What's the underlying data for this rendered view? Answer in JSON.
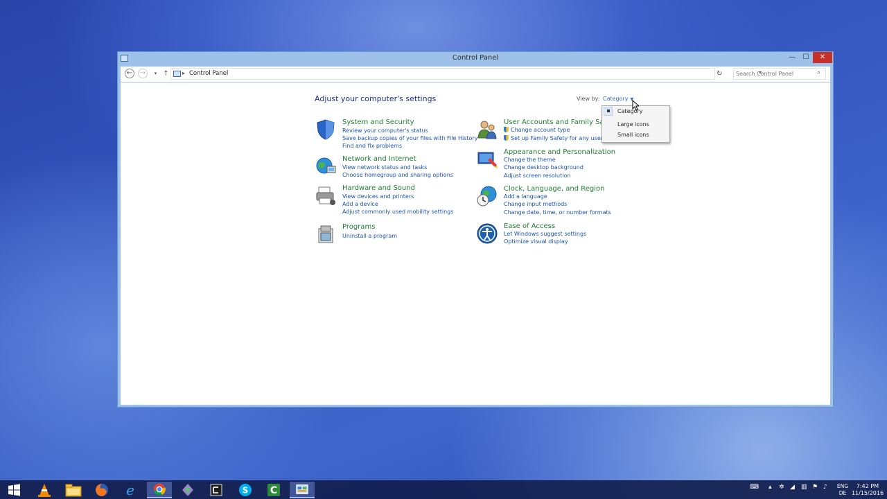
{
  "window": {
    "title": "Control Panel",
    "minimize_label": "—",
    "maximize_label": "☐",
    "close_label": "✕"
  },
  "address_bar": {
    "back_icon": "←",
    "forward_icon": "→",
    "recent_icon": "▾",
    "up_icon": "↑",
    "separator": "▸",
    "path": "Control Panel",
    "dropdown_icon": "▾",
    "refresh_icon": "↻",
    "search_placeholder": "Search Control Panel",
    "search_icon": "⌕"
  },
  "content": {
    "heading": "Adjust your computer's settings",
    "view_by_label": "View by:",
    "view_by_value": "Category",
    "view_by_arrow": "▼"
  },
  "dropdown": {
    "items": [
      "Category",
      "Large icons",
      "Small icons"
    ],
    "selected": "Category"
  },
  "categories_left": [
    {
      "title": "System and Security",
      "links": [
        "Review your computer's status",
        "Save backup copies of your files with File History",
        "Find and fix problems"
      ]
    },
    {
      "title": "Network and Internet",
      "links": [
        "View network status and tasks",
        "Choose homegroup and sharing options"
      ]
    },
    {
      "title": "Hardware and Sound",
      "links": [
        "View devices and printers",
        "Add a device",
        "Adjust commonly used mobility settings"
      ]
    },
    {
      "title": "Programs",
      "links": [
        "Uninstall a program"
      ]
    }
  ],
  "categories_right": [
    {
      "title": "User Accounts and Family Safety",
      "links": [
        "Change account type",
        "Set up Family Safety for any user"
      ]
    },
    {
      "title": "Appearance and Personalization",
      "links": [
        "Change the theme",
        "Change desktop background",
        "Adjust screen resolution"
      ]
    },
    {
      "title": "Clock, Language, and Region",
      "links": [
        "Add a language",
        "Change input methods",
        "Change date, time, or number formats"
      ]
    },
    {
      "title": "Ease of Access",
      "links": [
        "Let Windows suggest settings",
        "Optimize visual display"
      ]
    }
  ],
  "taskbar": {
    "apps": [
      "start-icon",
      "vlc-icon",
      "file-explorer-icon",
      "firefox-icon",
      "internet-explorer-icon",
      "chrome-icon",
      "app-icon",
      "terminal-icon",
      "skype-icon",
      "camtasia-icon",
      "control-panel-icon"
    ],
    "active_app": "control-panel-icon",
    "lang_top": "ENG",
    "lang_bottom": "DE",
    "time": "7:42 PM",
    "date": "11/15/2016"
  },
  "colors": {
    "category_title": "#1e7d32",
    "link": "#1a55b0",
    "heading": "#1e3287",
    "close_button": "#c8312a"
  }
}
